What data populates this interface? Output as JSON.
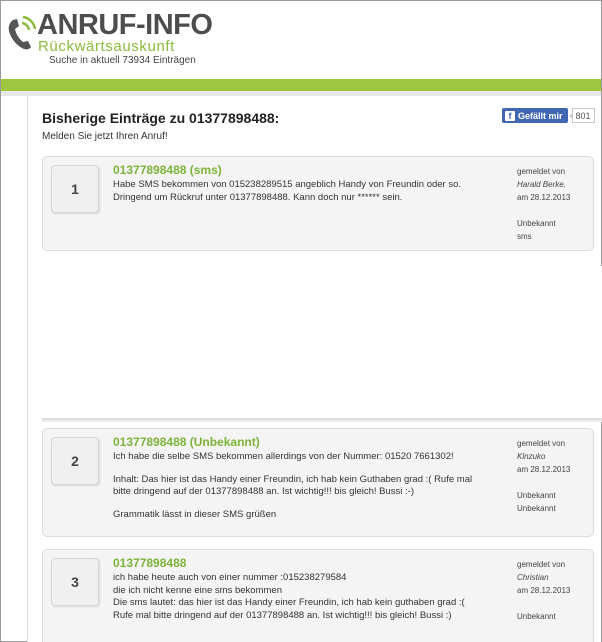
{
  "header": {
    "logo_title": "ANRUF-INFO",
    "logo_subtitle": "Rückwärtsauskunft",
    "logo_count": "Suche in aktuell 73934 Einträgen",
    "brand_green": "#9ec641",
    "logo_icon": "phone-signal-icon"
  },
  "page": {
    "title": "Bisherige Einträge zu 01377898488:",
    "subline": "Melden Sie jetzt Ihren Anruf!"
  },
  "facebook": {
    "like_label": "Gefällt mir",
    "like_count": "801",
    "icon": "facebook-icon"
  },
  "entries": [
    {
      "number": "1",
      "title": "01377898488 (sms)",
      "body": [
        "Habe SMS bekommen von 015238289515 angeblich Handy von Freundin oder so.",
        "Dringend um Rückruf unter 01377898488. Kann doch nur ****** sein."
      ],
      "reported_label": "gemeldet von",
      "reporter": "Harald Berke.",
      "date": "am 28.12.2013",
      "category": "Unbekannt",
      "type": "sms"
    },
    {
      "number": "2",
      "title": "01377898488 (Unbekannt)",
      "body": [
        "Ich habe die selbe SMS bekommen allerdings von der Nummer: 01520 7661302!",
        "Inhalt: Das hier ist das Handy einer Freundin, ich hab kein Guthaben grad :( Rufe mal",
        "bitte dringend auf der 01377898488 an. Ist wichtig!!! bis gleich! Bussi :-)",
        "Grammatik lässt in dieser SMS grüßen"
      ],
      "reported_label": "gemeldet von",
      "reporter": "Klnzuko",
      "date": "am 28.12.2013",
      "category": "Unbekannt",
      "type": "Unbekannt"
    },
    {
      "number": "3",
      "title": "01377898488",
      "body": [
        "ich habe heute auch von einer nummer :015238279584",
        "die ich nicht kenne eine sms bekommen",
        "Die sms lautet: das hier ist das Handy einer Freundin, ich hab kein guthaben grad :(",
        "Rufe mal bitte dringend auf der 01377898488 an. Ist wichtig!!! bis gleich! Bussi :)"
      ],
      "reported_label": "gemeldet von",
      "reporter": "Christian",
      "date": "am 28.12.2013",
      "category": "Unbekannt"
    }
  ]
}
